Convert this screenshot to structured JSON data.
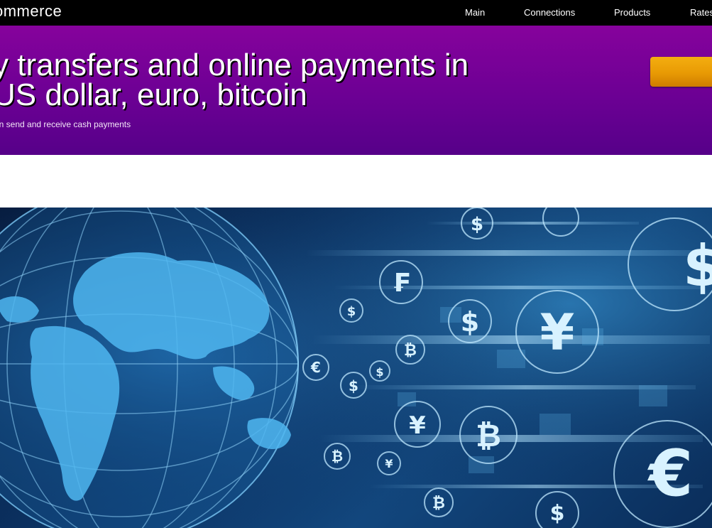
{
  "header": {
    "brand": "ommerce",
    "nav": {
      "main": "Main",
      "connections": "Connections",
      "products": "Products",
      "rates": "Rates"
    }
  },
  "hero": {
    "title_line1": "y transfers and online payments in",
    "title_line2": "US dollar, euro, bitcoin",
    "subtitle": "an send and receive cash payments"
  },
  "banner": {
    "currency_symbols": [
      "$",
      "₣",
      "$",
      "₿",
      "$",
      "¥",
      "€",
      "$",
      "₿",
      "$",
      "₿",
      "€",
      "$"
    ]
  },
  "colors": {
    "topbar": "#000000",
    "hero": "#6c0094",
    "cta": "#e89a04"
  }
}
